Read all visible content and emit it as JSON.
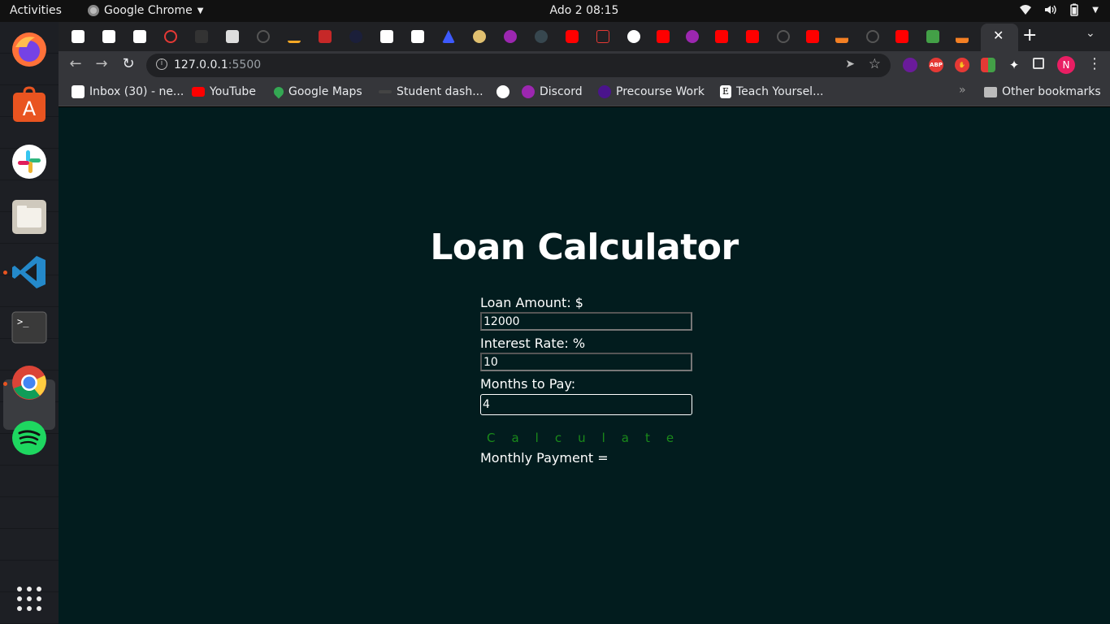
{
  "topbar": {
    "activities": "Activities",
    "app_name": "Google Chrome",
    "clock": "Ado 2  08:15"
  },
  "dock": {
    "items": [
      {
        "name": "firefox-icon",
        "color": "#ff7139"
      },
      {
        "name": "ubuntu-software-icon",
        "color": "#e95420"
      },
      {
        "name": "slack-icon",
        "color": "#ffffff"
      },
      {
        "name": "files-icon",
        "color": "#d8d4cc"
      },
      {
        "name": "vscode-icon",
        "color": "#2489ca"
      },
      {
        "name": "terminal-icon",
        "color": "#3a3a3a"
      },
      {
        "name": "chrome-icon",
        "color": "#4285f4"
      },
      {
        "name": "spotify-icon",
        "color": "#1ed760"
      }
    ]
  },
  "toolbar": {
    "url_host": "127.0.0.1",
    "url_port": ":5500",
    "profile_initial": "N"
  },
  "bookmarks": {
    "items": [
      {
        "label": "Inbox (30) - ne..."
      },
      {
        "label": "YouTube"
      },
      {
        "label": "Google Maps"
      },
      {
        "label": "Student dash..."
      },
      {
        "label": ""
      },
      {
        "label": "Discord"
      },
      {
        "label": "Precourse Work"
      },
      {
        "label": "Teach Yoursel..."
      }
    ],
    "more": "»",
    "other": "Other bookmarks"
  },
  "page": {
    "title": "Loan Calculator",
    "loan_amount_label": "Loan Amount: $",
    "loan_amount_value": "12000",
    "interest_rate_label": "Interest Rate: %",
    "interest_rate_value": "10",
    "months_label": "Months to Pay:",
    "months_value": "4",
    "calculate_label": "Calculate",
    "result_label": "Monthly Payment ="
  },
  "colors": {
    "page_bg": "#021c1e",
    "button_text": "#1a8a1a",
    "chrome_dark": "#202124",
    "chrome_toolbar": "#35363a"
  }
}
